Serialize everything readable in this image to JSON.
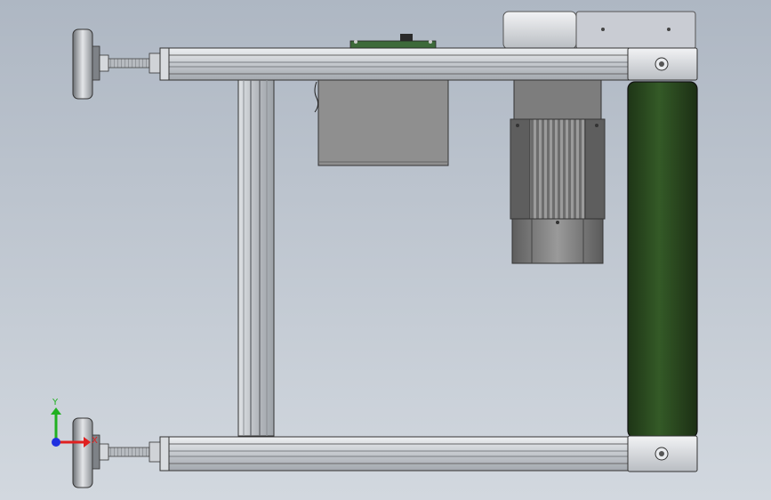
{
  "viewport": {
    "background_top": "#aeb7c3",
    "background_bottom": "#d2d8df"
  },
  "model": {
    "parts": [
      "leveling-foot-top",
      "leveling-foot-bottom",
      "aluminum-profile-top",
      "aluminum-profile-bottom",
      "vertical-profile",
      "control-box",
      "gear-motor",
      "conveyor-belt-roller",
      "end-caps"
    ],
    "colors": {
      "belt": "#2e4a22",
      "profile": "#c9cdd2",
      "control_box": "#8f8f8f",
      "motor": "#7a7a7a",
      "pcb": "#3d6a3a"
    }
  },
  "triad": {
    "x_label": "X",
    "y_label": "Y",
    "x_color": "#e02020",
    "y_color": "#20b020",
    "z_color": "#2030e0"
  }
}
